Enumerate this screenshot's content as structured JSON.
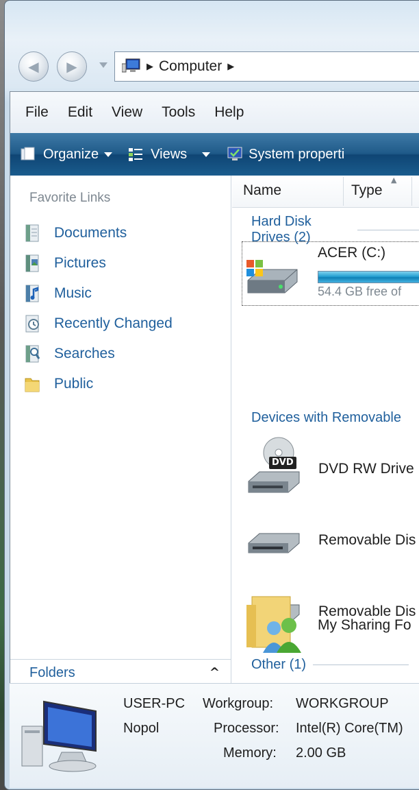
{
  "address": {
    "breadcrumb": "Computer"
  },
  "menu": [
    "File",
    "Edit",
    "View",
    "Tools",
    "Help"
  ],
  "toolbar": {
    "organize": "Organize",
    "views": "Views",
    "system_properties": "System properti"
  },
  "nav": {
    "heading": "Favorite Links",
    "links": [
      "Documents",
      "Pictures",
      "Music",
      "Recently Changed",
      "Searches",
      "Public"
    ],
    "folders": "Folders"
  },
  "columns": {
    "name": "Name",
    "type": "Type"
  },
  "groups": {
    "hdd": "Hard Disk Drives (2)",
    "removable": "Devices with Removable",
    "other": "Other (1)"
  },
  "items": {
    "acer": {
      "name": "ACER (C:)",
      "free": "54.4 GB free of"
    },
    "dvd": {
      "name": "DVD RW Drive",
      "badge": "DVD"
    },
    "removable1": {
      "name": "Removable Dis"
    },
    "removable2": {
      "name": "Removable Dis"
    },
    "sharing": {
      "name": "My Sharing Fo"
    }
  },
  "details": {
    "computer_name": "USER-PC",
    "user": "Nopol",
    "workgroup_label": "Workgroup:",
    "workgroup": "WORKGROUP",
    "processor_label": "Processor:",
    "processor": "Intel(R) Core(TM)",
    "memory_label": "Memory:",
    "memory": "2.00 GB"
  }
}
